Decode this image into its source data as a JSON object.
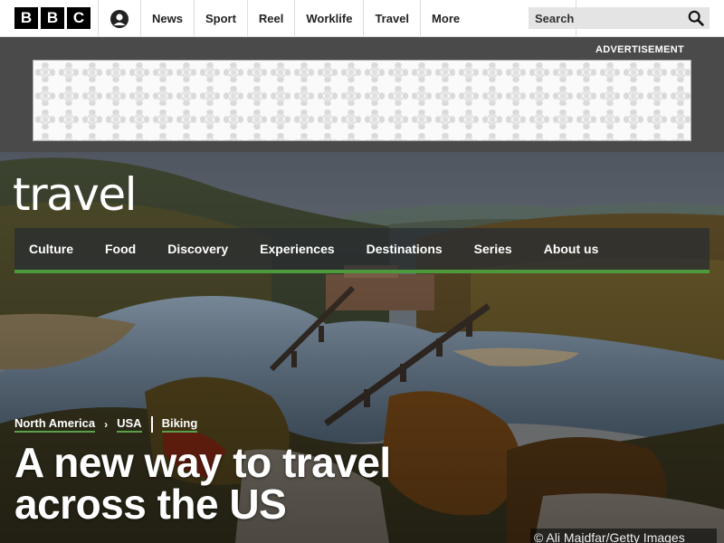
{
  "header": {
    "logo_letters": [
      "B",
      "B",
      "C"
    ],
    "account_icon": "person-icon",
    "nav": [
      "News",
      "Sport",
      "Reel",
      "Worklife",
      "Travel"
    ],
    "more_label": "More",
    "search_placeholder": "Search"
  },
  "ad": {
    "label": "ADVERTISEMENT"
  },
  "hero": {
    "brand": "travel",
    "sections": [
      "Culture",
      "Food",
      "Discovery",
      "Experiences",
      "Destinations",
      "Series",
      "About us"
    ],
    "breadcrumbs": [
      "North America",
      "USA",
      "Biking"
    ],
    "headline_line1": "A new way to travel",
    "headline_line2": "across the US",
    "credit": "© Ali Majdfar/Getty Images"
  },
  "colors": {
    "accent_green": "#4c9a3c",
    "ad_band": "#4a4a4a"
  }
}
